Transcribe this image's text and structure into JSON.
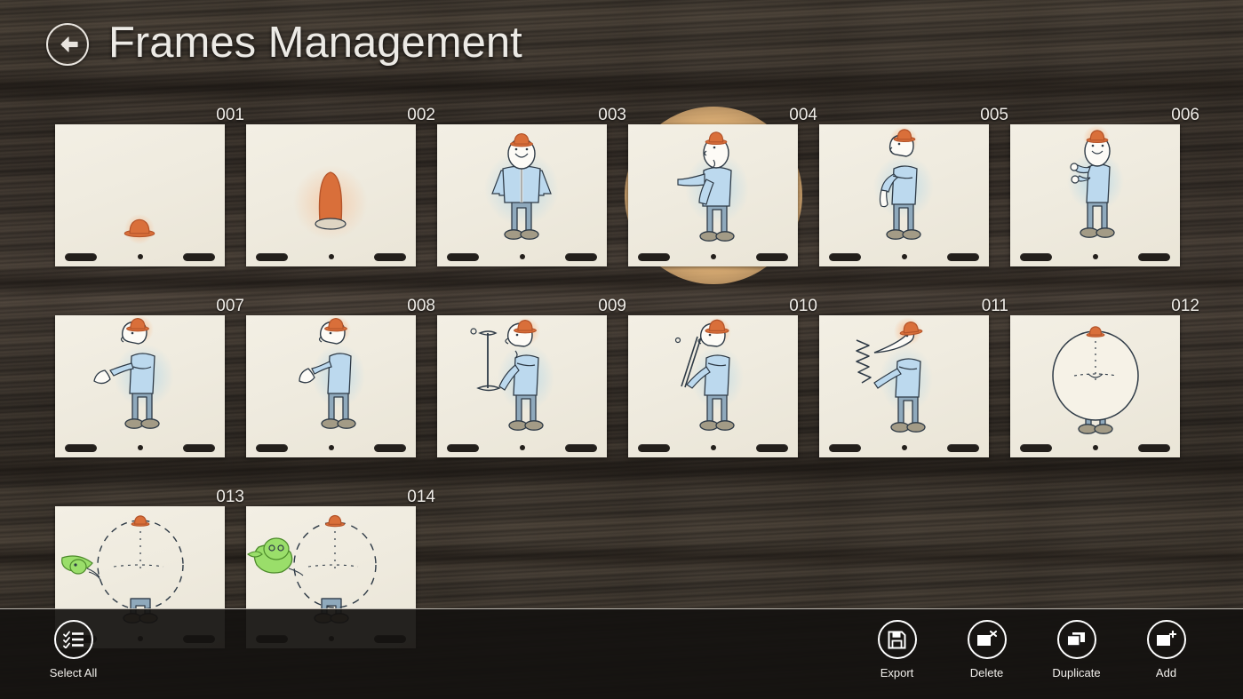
{
  "app": {
    "title": "Frames Management",
    "background": "wood-dark-texture",
    "background_color": "#3c352e"
  },
  "header": {
    "back_icon": "back-arrow-circle-icon",
    "title": "Frames Management",
    "title_color": "#eceae5"
  },
  "grid": {
    "columns": 6,
    "frame_count": 14,
    "frames": [
      {
        "id": "001",
        "label": "001",
        "selected": false,
        "highlight": false,
        "art": "hat-only"
      },
      {
        "id": "002",
        "label": "002",
        "selected": false,
        "highlight": false,
        "art": "hat-tall"
      },
      {
        "id": "003",
        "label": "003",
        "selected": false,
        "highlight": false,
        "art": "character-front"
      },
      {
        "id": "004",
        "label": "004",
        "selected": false,
        "highlight": true,
        "art": "character-pointing"
      },
      {
        "id": "005",
        "label": "005",
        "selected": false,
        "highlight": false,
        "art": "character-holding-cloth"
      },
      {
        "id": "006",
        "label": "006",
        "selected": false,
        "highlight": false,
        "art": "character-hands-up"
      },
      {
        "id": "007",
        "label": "007",
        "selected": false,
        "highlight": false,
        "art": "character-balloon-small"
      },
      {
        "id": "008",
        "label": "008",
        "selected": false,
        "highlight": false,
        "art": "character-balloon-loose"
      },
      {
        "id": "009",
        "label": "009",
        "selected": false,
        "highlight": false,
        "art": "character-with-pump"
      },
      {
        "id": "010",
        "label": "010",
        "selected": false,
        "highlight": false,
        "art": "character-with-stick"
      },
      {
        "id": "011",
        "label": "011",
        "selected": false,
        "highlight": false,
        "art": "character-blowing"
      },
      {
        "id": "012",
        "label": "012",
        "selected": false,
        "highlight": false,
        "art": "inflated-balloon"
      },
      {
        "id": "013",
        "label": "013",
        "selected": false,
        "highlight": false,
        "art": "balloon-with-green-bird"
      },
      {
        "id": "014",
        "label": "014",
        "selected": false,
        "highlight": false,
        "art": "balloon-with-green-creature"
      }
    ]
  },
  "appbar": {
    "left_commands": [
      {
        "id": "select-all",
        "label": "Select All",
        "icon": "checklist-icon"
      }
    ],
    "right_commands": [
      {
        "id": "export",
        "label": "Export",
        "icon": "save-floppy-icon"
      },
      {
        "id": "delete",
        "label": "Delete",
        "icon": "frame-delete-icon"
      },
      {
        "id": "duplicate",
        "label": "Duplicate",
        "icon": "frame-duplicate-icon"
      },
      {
        "id": "add",
        "label": "Add",
        "icon": "frame-add-icon"
      }
    ]
  }
}
